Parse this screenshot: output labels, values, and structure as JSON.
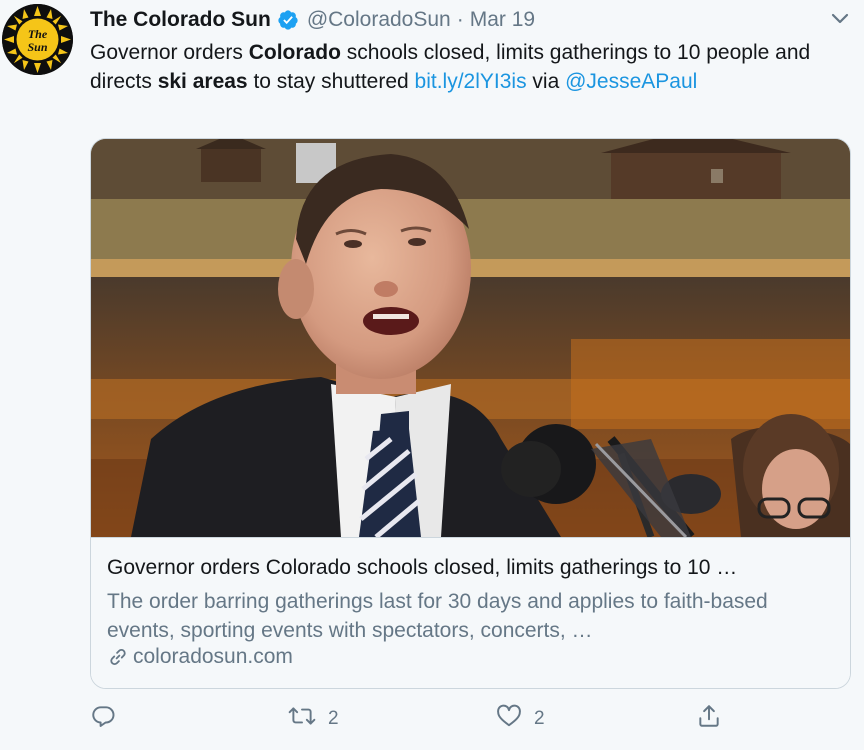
{
  "tweet": {
    "display_name": "The Colorado Sun",
    "handle": "@ColoradoSun",
    "separator": "·",
    "date": "Mar 19",
    "avatar_text": [
      "The",
      "Sun"
    ],
    "text": {
      "p1": "Governor orders ",
      "b1": "Colorado",
      "p2": " schools closed, limits gatherings to 10 people and directs ",
      "b2": "ski areas",
      "p3": " to stay shuttered ",
      "link": "bit.ly/2lYI3is",
      "p4": " via ",
      "mention": "@JesseAPaul"
    }
  },
  "card": {
    "title": "Governor orders Colorado schools closed, limits gatherings to 10 …",
    "description": "The order barring gatherings last for 30 days and applies to faith-based events, sporting events with spectators, concerts, …",
    "domain": "coloradosun.com"
  },
  "actions": {
    "reply_count": "",
    "retweet_count": "2",
    "like_count": "2"
  },
  "colors": {
    "link": "#1b95e0",
    "secondary": "#657786",
    "verified": "#1da1f2",
    "avatar_yellow": "#f5c518"
  },
  "icons": [
    "verified-badge-icon",
    "chevron-down-icon",
    "link-icon",
    "reply-icon",
    "retweet-icon",
    "like-icon",
    "share-icon"
  ]
}
